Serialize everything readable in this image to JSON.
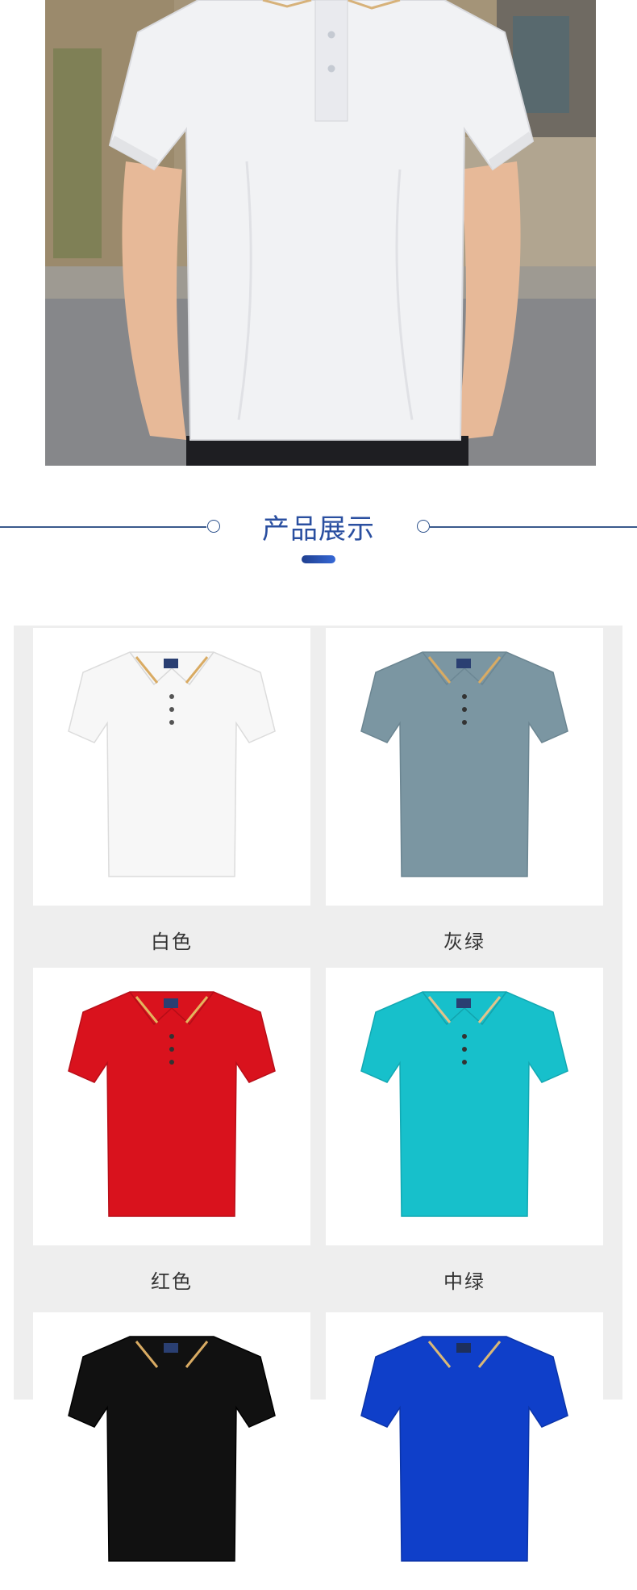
{
  "section": {
    "title": "产品展示"
  },
  "colors": {
    "accent": "#2a4fa0",
    "line": "#3a5a8c",
    "grid_bg": "#eeeeee"
  },
  "products": [
    {
      "label": "白色",
      "shirt_color": "#f7f7f7"
    },
    {
      "label": "灰绿",
      "shirt_color": "#7b96a2"
    },
    {
      "label": "红色",
      "shirt_color": "#d9121d"
    },
    {
      "label": "中绿",
      "shirt_color": "#17c0cb"
    },
    {
      "label": "",
      "shirt_color": "#111111"
    },
    {
      "label": "",
      "shirt_color": "#0f3fc9"
    }
  ]
}
